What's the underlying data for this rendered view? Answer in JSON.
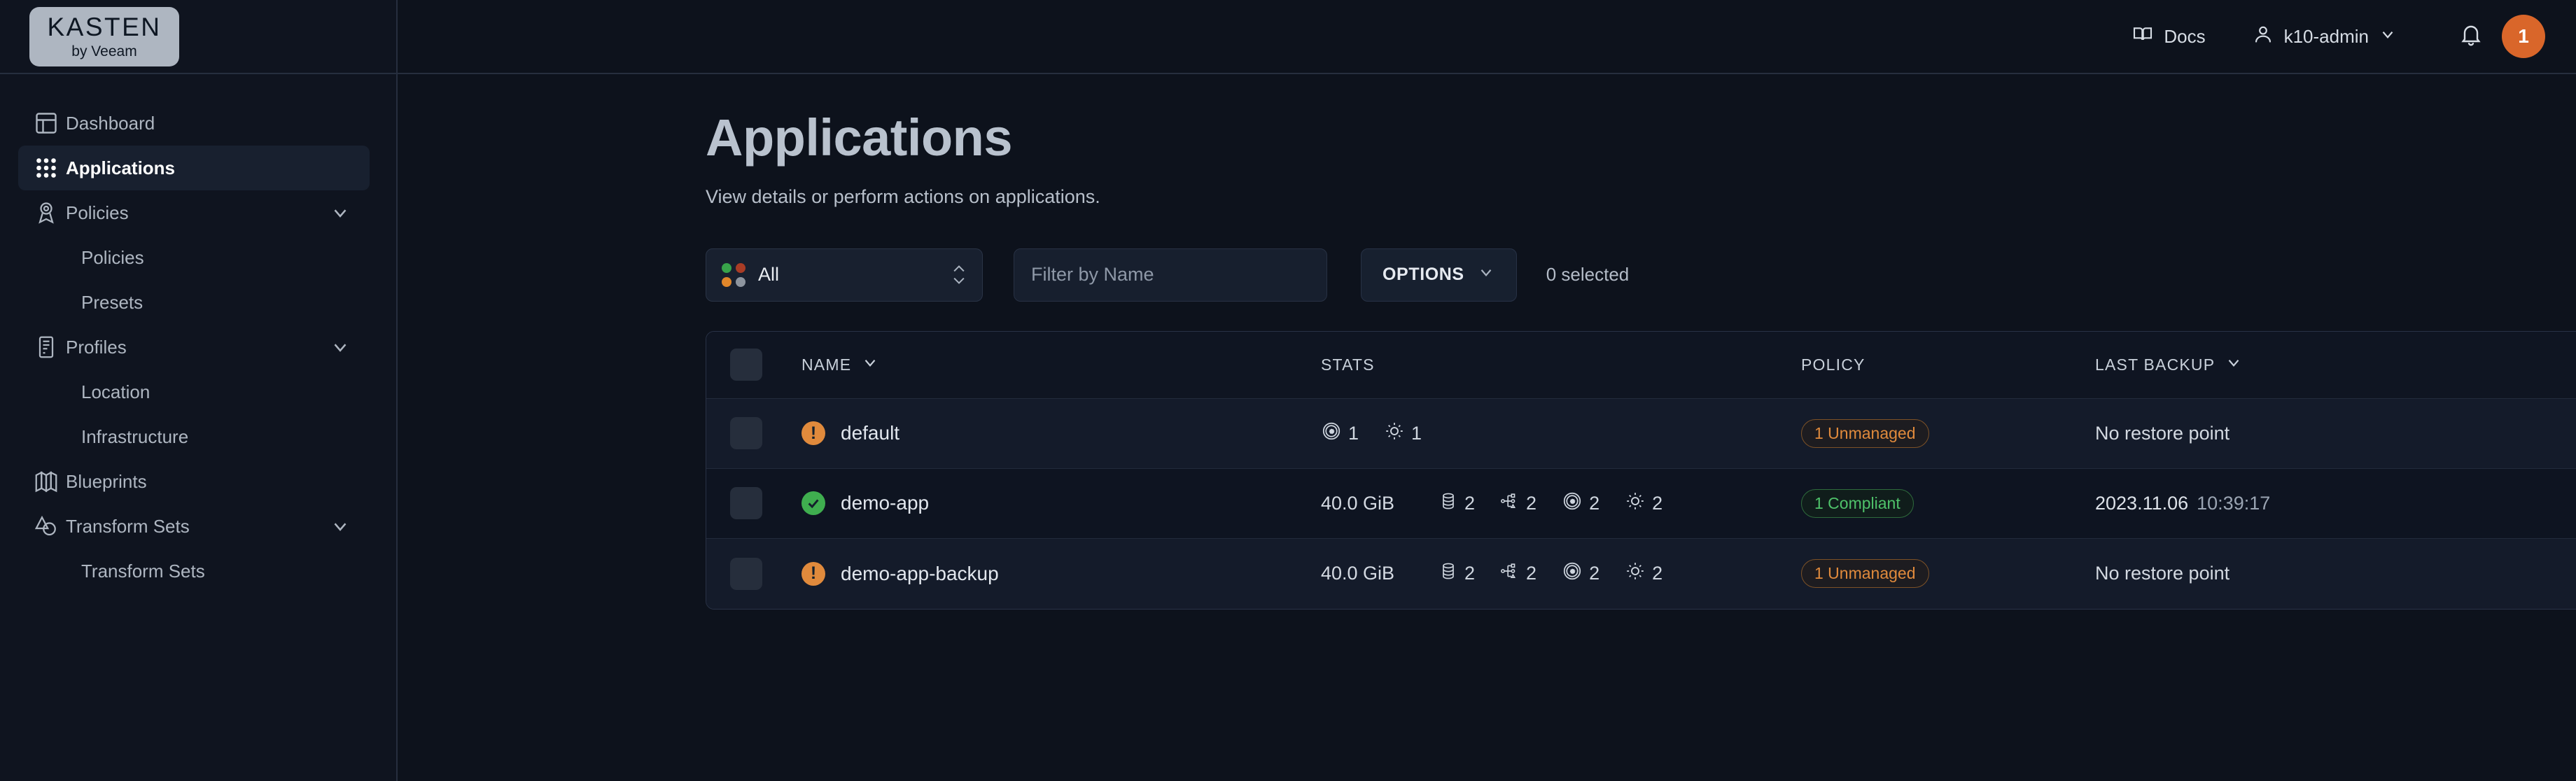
{
  "brand": {
    "logo_top": "KASTEN",
    "logo_bottom": "by Veeam"
  },
  "topbar": {
    "docs_label": "Docs",
    "user_label": "k10-admin",
    "notification_count": "1"
  },
  "sidebar": {
    "items": [
      {
        "label": "Dashboard",
        "icon": "dashboard-icon",
        "type": "item",
        "active": false,
        "expandable": false
      },
      {
        "label": "Applications",
        "icon": "grid-dots-icon",
        "type": "item",
        "active": true,
        "expandable": false
      },
      {
        "label": "Policies",
        "icon": "ribbon-icon",
        "type": "item",
        "active": false,
        "expandable": true
      },
      {
        "label": "Policies",
        "icon": "",
        "type": "sub",
        "active": false,
        "expandable": false
      },
      {
        "label": "Presets",
        "icon": "",
        "type": "sub",
        "active": false,
        "expandable": false
      },
      {
        "label": "Profiles",
        "icon": "document-icon",
        "type": "item",
        "active": false,
        "expandable": true
      },
      {
        "label": "Location",
        "icon": "",
        "type": "sub",
        "active": false,
        "expandable": false
      },
      {
        "label": "Infrastructure",
        "icon": "",
        "type": "sub",
        "active": false,
        "expandable": false
      },
      {
        "label": "Blueprints",
        "icon": "map-icon",
        "type": "item",
        "active": false,
        "expandable": false
      },
      {
        "label": "Transform Sets",
        "icon": "shapes-icon",
        "type": "item",
        "active": false,
        "expandable": true
      },
      {
        "label": "Transform Sets",
        "icon": "",
        "type": "sub",
        "active": false,
        "expandable": false
      }
    ]
  },
  "page": {
    "title": "Applications",
    "subtitle": "View details or perform actions on applications."
  },
  "toolbar": {
    "status_filter_value": "All",
    "status_filter_dot_colors": [
      "#38a34a",
      "#a93c25",
      "#e0862a",
      "#8d949e"
    ],
    "name_filter_placeholder": "Filter by Name",
    "name_filter_value": "",
    "options_label": "OPTIONS",
    "selected_count_label": "0 selected"
  },
  "table": {
    "columns": [
      {
        "key": "name",
        "label": "NAME",
        "sortable": true
      },
      {
        "key": "stats",
        "label": "STATS",
        "sortable": false
      },
      {
        "key": "policy",
        "label": "POLICY",
        "sortable": false
      },
      {
        "key": "last_backup",
        "label": "LAST BACKUP",
        "sortable": true
      }
    ],
    "rows": [
      {
        "name": "default",
        "status": "warning",
        "size": "",
        "stats": [
          {
            "icon": "pod-icon",
            "value": "1"
          },
          {
            "icon": "config-gear-icon",
            "value": "1"
          }
        ],
        "policy_label": "1 Unmanaged",
        "policy_state": "unmanaged",
        "backup_date": "",
        "backup_time": "",
        "backup_none": "No restore point"
      },
      {
        "name": "demo-app",
        "status": "ok",
        "size": "40.0 GiB",
        "stats": [
          {
            "icon": "volume-icon",
            "value": "2"
          },
          {
            "icon": "topology-icon",
            "value": "2"
          },
          {
            "icon": "pod-icon",
            "value": "2"
          },
          {
            "icon": "config-gear-icon",
            "value": "2"
          }
        ],
        "policy_label": "1 Compliant",
        "policy_state": "compliant",
        "backup_date": "2023.11.06",
        "backup_time": "10:39:17",
        "backup_none": ""
      },
      {
        "name": "demo-app-backup",
        "status": "warning",
        "size": "40.0 GiB",
        "stats": [
          {
            "icon": "volume-icon",
            "value": "2"
          },
          {
            "icon": "topology-icon",
            "value": "2"
          },
          {
            "icon": "pod-icon",
            "value": "2"
          },
          {
            "icon": "config-gear-icon",
            "value": "2"
          }
        ],
        "policy_label": "1 Unmanaged",
        "policy_state": "unmanaged",
        "backup_date": "",
        "backup_time": "",
        "backup_none": "No restore point"
      }
    ]
  },
  "colors": {
    "accent_orange": "#d9662a",
    "status_warning": "#e08a3c",
    "status_ok": "#3fae4f",
    "compliant_green": "#4fc26a",
    "page_bg": "#0d121c",
    "sidebar_bg": "#0f141f"
  }
}
